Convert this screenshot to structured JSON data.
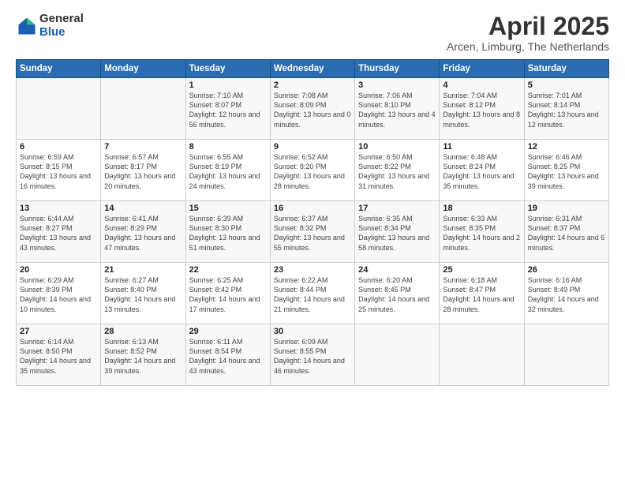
{
  "logo": {
    "general": "General",
    "blue": "Blue"
  },
  "title": "April 2025",
  "subtitle": "Arcen, Limburg, The Netherlands",
  "days_of_week": [
    "Sunday",
    "Monday",
    "Tuesday",
    "Wednesday",
    "Thursday",
    "Friday",
    "Saturday"
  ],
  "weeks": [
    [
      {
        "day": "",
        "info": ""
      },
      {
        "day": "",
        "info": ""
      },
      {
        "day": "1",
        "info": "Sunrise: 7:10 AM\nSunset: 8:07 PM\nDaylight: 12 hours and 56 minutes."
      },
      {
        "day": "2",
        "info": "Sunrise: 7:08 AM\nSunset: 8:09 PM\nDaylight: 13 hours and 0 minutes."
      },
      {
        "day": "3",
        "info": "Sunrise: 7:06 AM\nSunset: 8:10 PM\nDaylight: 13 hours and 4 minutes."
      },
      {
        "day": "4",
        "info": "Sunrise: 7:04 AM\nSunset: 8:12 PM\nDaylight: 13 hours and 8 minutes."
      },
      {
        "day": "5",
        "info": "Sunrise: 7:01 AM\nSunset: 8:14 PM\nDaylight: 13 hours and 12 minutes."
      }
    ],
    [
      {
        "day": "6",
        "info": "Sunrise: 6:59 AM\nSunset: 8:15 PM\nDaylight: 13 hours and 16 minutes."
      },
      {
        "day": "7",
        "info": "Sunrise: 6:57 AM\nSunset: 8:17 PM\nDaylight: 13 hours and 20 minutes."
      },
      {
        "day": "8",
        "info": "Sunrise: 6:55 AM\nSunset: 8:19 PM\nDaylight: 13 hours and 24 minutes."
      },
      {
        "day": "9",
        "info": "Sunrise: 6:52 AM\nSunset: 8:20 PM\nDaylight: 13 hours and 28 minutes."
      },
      {
        "day": "10",
        "info": "Sunrise: 6:50 AM\nSunset: 8:22 PM\nDaylight: 13 hours and 31 minutes."
      },
      {
        "day": "11",
        "info": "Sunrise: 6:48 AM\nSunset: 8:24 PM\nDaylight: 13 hours and 35 minutes."
      },
      {
        "day": "12",
        "info": "Sunrise: 6:46 AM\nSunset: 8:25 PM\nDaylight: 13 hours and 39 minutes."
      }
    ],
    [
      {
        "day": "13",
        "info": "Sunrise: 6:44 AM\nSunset: 8:27 PM\nDaylight: 13 hours and 43 minutes."
      },
      {
        "day": "14",
        "info": "Sunrise: 6:41 AM\nSunset: 8:29 PM\nDaylight: 13 hours and 47 minutes."
      },
      {
        "day": "15",
        "info": "Sunrise: 6:39 AM\nSunset: 8:30 PM\nDaylight: 13 hours and 51 minutes."
      },
      {
        "day": "16",
        "info": "Sunrise: 6:37 AM\nSunset: 8:32 PM\nDaylight: 13 hours and 55 minutes."
      },
      {
        "day": "17",
        "info": "Sunrise: 6:35 AM\nSunset: 8:34 PM\nDaylight: 13 hours and 58 minutes."
      },
      {
        "day": "18",
        "info": "Sunrise: 6:33 AM\nSunset: 8:35 PM\nDaylight: 14 hours and 2 minutes."
      },
      {
        "day": "19",
        "info": "Sunrise: 6:31 AM\nSunset: 8:37 PM\nDaylight: 14 hours and 6 minutes."
      }
    ],
    [
      {
        "day": "20",
        "info": "Sunrise: 6:29 AM\nSunset: 8:39 PM\nDaylight: 14 hours and 10 minutes."
      },
      {
        "day": "21",
        "info": "Sunrise: 6:27 AM\nSunset: 8:40 PM\nDaylight: 14 hours and 13 minutes."
      },
      {
        "day": "22",
        "info": "Sunrise: 6:25 AM\nSunset: 8:42 PM\nDaylight: 14 hours and 17 minutes."
      },
      {
        "day": "23",
        "info": "Sunrise: 6:22 AM\nSunset: 8:44 PM\nDaylight: 14 hours and 21 minutes."
      },
      {
        "day": "24",
        "info": "Sunrise: 6:20 AM\nSunset: 8:45 PM\nDaylight: 14 hours and 25 minutes."
      },
      {
        "day": "25",
        "info": "Sunrise: 6:18 AM\nSunset: 8:47 PM\nDaylight: 14 hours and 28 minutes."
      },
      {
        "day": "26",
        "info": "Sunrise: 6:16 AM\nSunset: 8:49 PM\nDaylight: 14 hours and 32 minutes."
      }
    ],
    [
      {
        "day": "27",
        "info": "Sunrise: 6:14 AM\nSunset: 8:50 PM\nDaylight: 14 hours and 35 minutes."
      },
      {
        "day": "28",
        "info": "Sunrise: 6:13 AM\nSunset: 8:52 PM\nDaylight: 14 hours and 39 minutes."
      },
      {
        "day": "29",
        "info": "Sunrise: 6:11 AM\nSunset: 8:54 PM\nDaylight: 14 hours and 43 minutes."
      },
      {
        "day": "30",
        "info": "Sunrise: 6:09 AM\nSunset: 8:55 PM\nDaylight: 14 hours and 46 minutes."
      },
      {
        "day": "",
        "info": ""
      },
      {
        "day": "",
        "info": ""
      },
      {
        "day": "",
        "info": ""
      }
    ]
  ]
}
